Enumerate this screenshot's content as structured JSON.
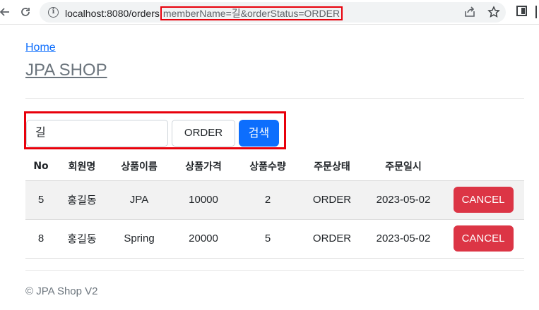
{
  "browser": {
    "url_host": "localhost:8080/orders",
    "url_query": "memberName=길&orderStatus=ORDER"
  },
  "nav": {
    "home_label": "Home",
    "brand": "JPA SHOP"
  },
  "search": {
    "member_name_value": "길",
    "order_status_value": "ORDER",
    "button_label": "검색"
  },
  "table": {
    "headers": [
      "No",
      "회원명",
      "상품이름",
      "상품가격",
      "상품수량",
      "주문상태",
      "주문일시",
      ""
    ],
    "rows": [
      {
        "no": "5",
        "member": "홍길동",
        "item": "JPA",
        "price": "10000",
        "count": "2",
        "status": "ORDER",
        "date": "2023-05-02",
        "action": "CANCEL"
      },
      {
        "no": "8",
        "member": "홍길동",
        "item": "Spring",
        "price": "20000",
        "count": "5",
        "status": "ORDER",
        "date": "2023-05-02",
        "action": "CANCEL"
      }
    ]
  },
  "footer": {
    "text": "© JPA Shop V2"
  },
  "colors": {
    "primary": "#0d6efd",
    "danger": "#dc3545",
    "highlight": "#e8000b"
  }
}
